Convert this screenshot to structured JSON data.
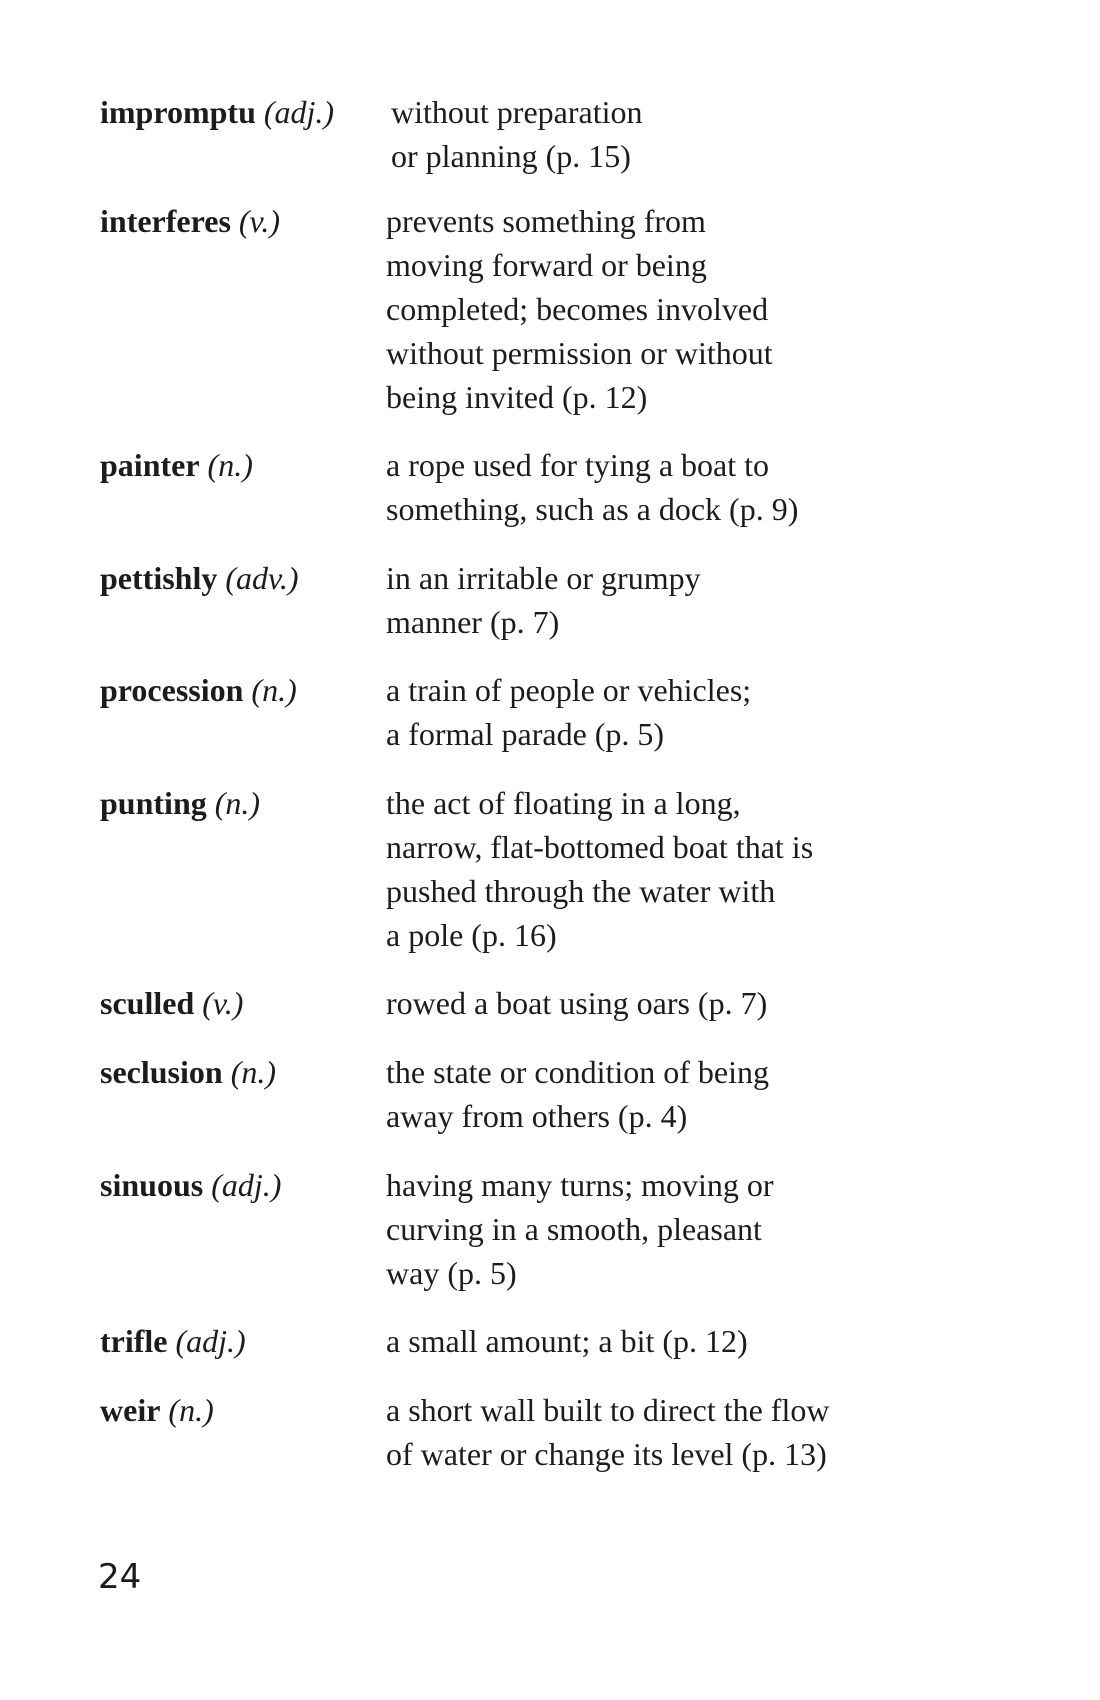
{
  "entries": [
    {
      "term": "impromptu",
      "pos": "(adj.)",
      "lines": [
        "without preparation",
        "or planning (p. 15)"
      ]
    },
    {
      "term": "interferes",
      "pos": "(v.)",
      "lines": [
        "prevents something from",
        "moving forward or being",
        "completed; becomes involved",
        "without permission or without",
        "being invited (p. 12)"
      ]
    },
    {
      "term": "painter",
      "pos": "(n.)",
      "lines": [
        "a rope used for tying a boat to",
        "something, such as a dock (p. 9)"
      ]
    },
    {
      "term": "pettishly",
      "pos": "(adv.)",
      "lines": [
        "in an irritable or grumpy",
        "manner (p. 7)"
      ]
    },
    {
      "term": "procession",
      "pos": "(n.)",
      "lines": [
        "a train of people or vehicles;",
        "a formal parade (p. 5)"
      ]
    },
    {
      "term": "punting",
      "pos": "(n.)",
      "lines": [
        "the act of floating in a long,",
        "narrow, flat-bottomed boat that is",
        "pushed through the water with",
        "a pole (p. 16)"
      ]
    },
    {
      "term": "sculled",
      "pos": "(v.)",
      "lines": [
        "rowed a boat using oars (p. 7)"
      ]
    },
    {
      "term": "seclusion",
      "pos": "(n.)",
      "lines": [
        "the state or condition of being",
        "away from others (p. 4)"
      ]
    },
    {
      "term": "sinuous",
      "pos": "(adj.)",
      "lines": [
        "having many turns; moving or",
        "curving in a smooth, pleasant",
        "way (p. 5)"
      ]
    },
    {
      "term": "trifle",
      "pos": "(adj.)",
      "lines": [
        "a small amount; a bit (p. 12)"
      ]
    },
    {
      "term": "weir",
      "pos": "(n.)",
      "lines": [
        "a short wall built to direct the flow",
        "of water or change its level (p. 13)"
      ]
    }
  ],
  "page_number": "24"
}
